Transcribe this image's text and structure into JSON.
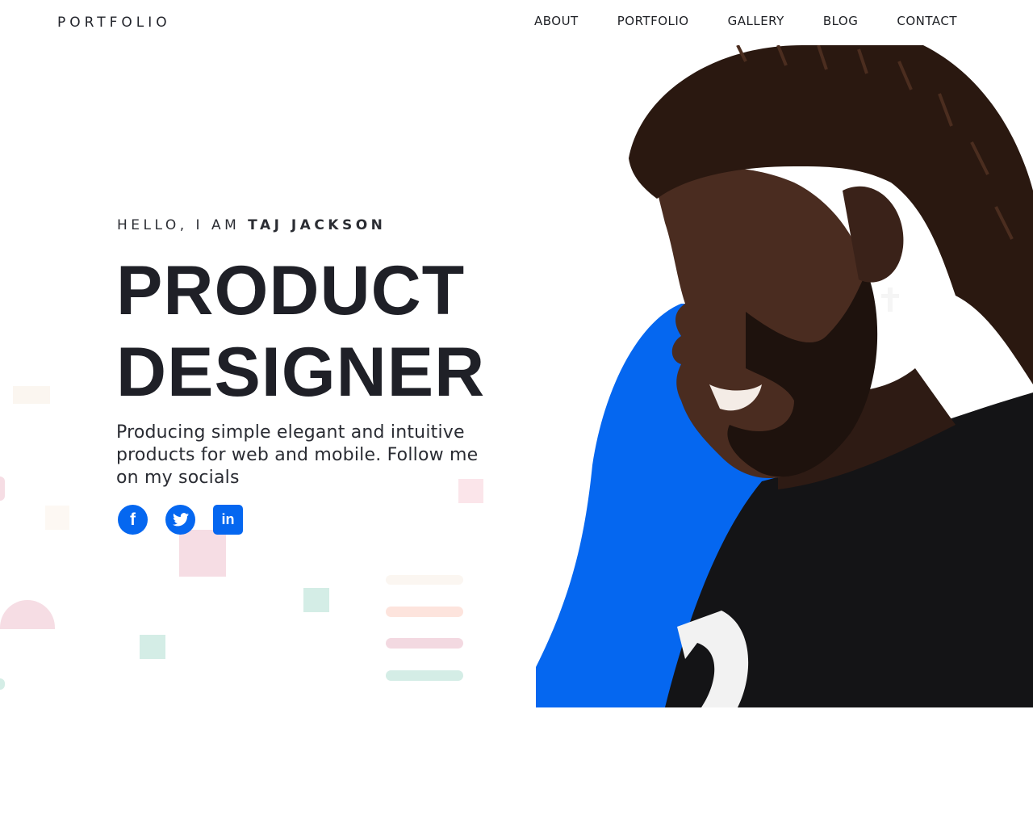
{
  "header": {
    "logo": "PORTFOLIO",
    "nav": [
      "ABOUT",
      "PORTFOLIO",
      "GALLERY",
      "BLOG",
      "CONTACT"
    ]
  },
  "hero": {
    "greeting_prefix": "HELLO, I AM ",
    "name": "TAJ JACKSON",
    "title_line1": "PRODUCT",
    "title_line2": "DESIGNER",
    "description": "Producing simple elegant and intuitive products for web and mobile. Follow me on my socials"
  },
  "socials": [
    {
      "icon": "facebook-icon",
      "glyph": "f"
    },
    {
      "icon": "twitter-icon",
      "glyph": "t"
    },
    {
      "icon": "linkedin-icon",
      "glyph": "in"
    }
  ],
  "colors": {
    "accent": "#0567f0",
    "text": "#22242b",
    "shirt": "#141416",
    "skin": "#3a2219"
  }
}
